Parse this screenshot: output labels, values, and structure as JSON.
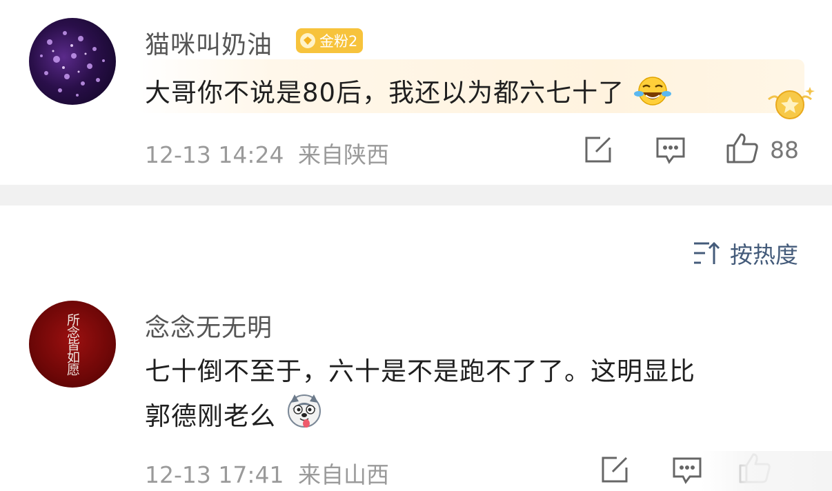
{
  "comments": [
    {
      "username": "猫咪叫奶油",
      "badge": "金粉2",
      "text": "大哥你不说是80后，我还以为都六七十了",
      "emoji": "laugh-cry-emoji",
      "time": "12-13 14:24",
      "location": "来自陕西",
      "likes": "88"
    },
    {
      "username": "念念无无明",
      "avatar_calligraphy": "所念皆如愿",
      "text_line1": "七十倒不至于，六十是不是跑不了了。这明显比",
      "text_line2": "郭德刚老么",
      "emoji": "husky-dog-emoji",
      "time": "12-13 17:41",
      "location": "来自山西"
    }
  ],
  "sort": {
    "label": "按热度",
    "icon": "sort-icon"
  },
  "colors": {
    "badge_gold": "#f7c33c",
    "sort_blue": "#445b7a",
    "meta_gray": "#9a9a9a",
    "divider": "#f1f1f1"
  }
}
